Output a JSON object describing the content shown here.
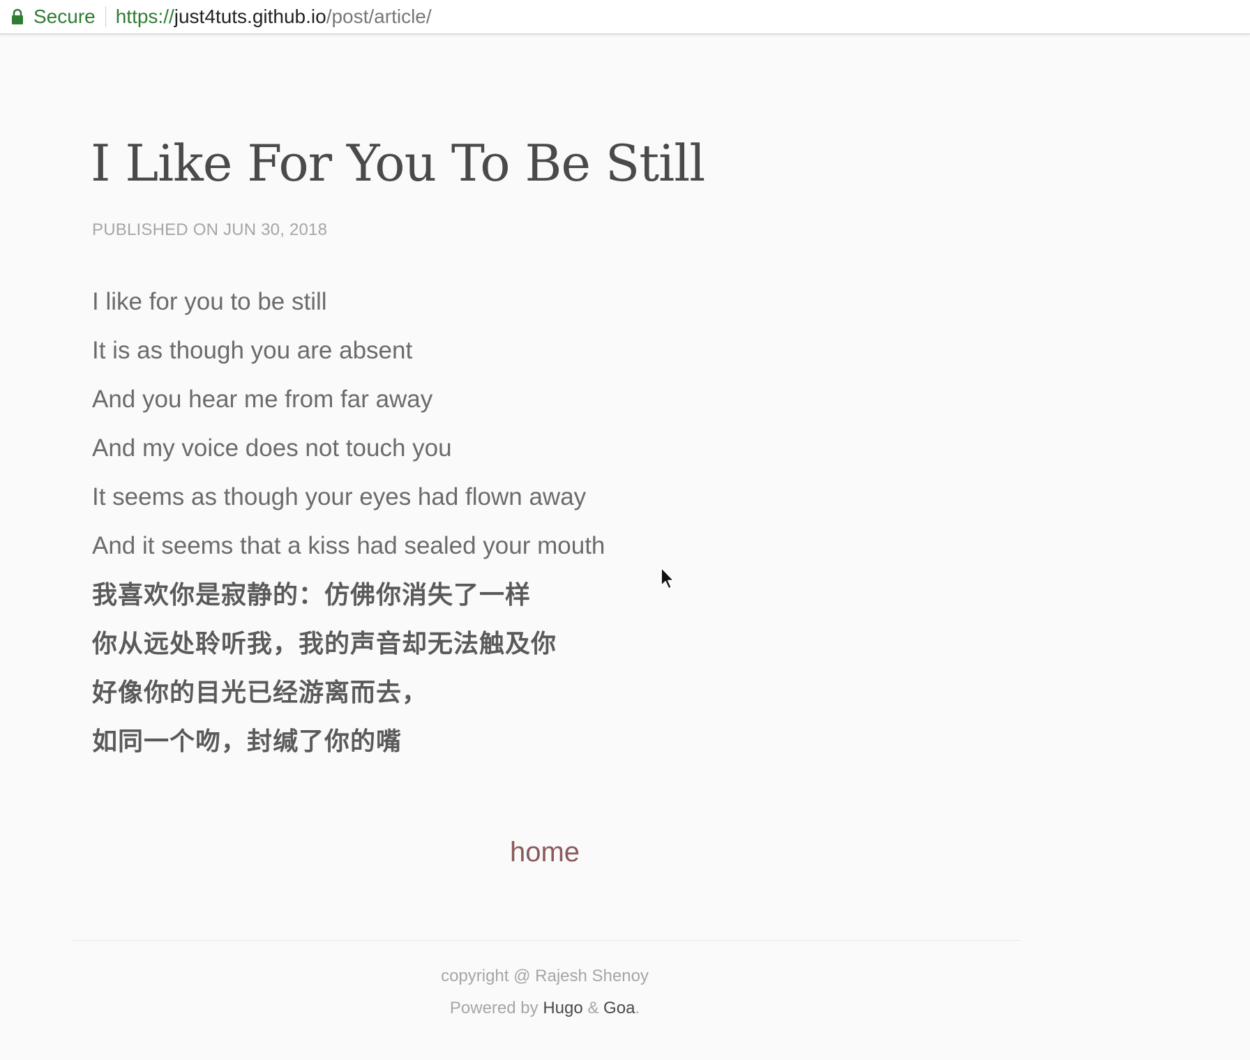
{
  "browser": {
    "secure_label": "Secure",
    "url_scheme": "https://",
    "url_host": "just4tuts.github.io",
    "url_path": "/post/article/"
  },
  "post": {
    "title": "I Like For You To Be Still",
    "meta": "PUBLISHED ON JUN 30, 2018",
    "lines": [
      "I like for you to be still",
      "It is as though you are absent",
      "And you hear me from far away",
      "And my voice does not touch you",
      "It seems as though your eyes had flown away",
      "And it seems that a kiss had sealed your mouth",
      "我喜欢你是寂静的：仿佛你消失了一样",
      "你从远处聆听我，我的声音却无法触及你",
      "好像你的目光已经游离而去，",
      "如同一个吻，封缄了你的嘴"
    ]
  },
  "nav": {
    "home_label": "home"
  },
  "footer": {
    "copyright": "copyright @ Rajesh Shenoy",
    "powered_prefix": "Powered by",
    "hugo": "Hugo",
    "amp": "&",
    "goa": "Goa",
    "period": "."
  },
  "colors": {
    "secure_green": "#2e7d32",
    "title": "#4a4a4a",
    "meta": "#a6a6a6",
    "body_text": "#6b6b6b",
    "home_link": "#8a5a5c",
    "background": "#fafafa"
  },
  "icons": {
    "lock": "lock-icon",
    "cursor": "mouse-cursor-icon"
  }
}
